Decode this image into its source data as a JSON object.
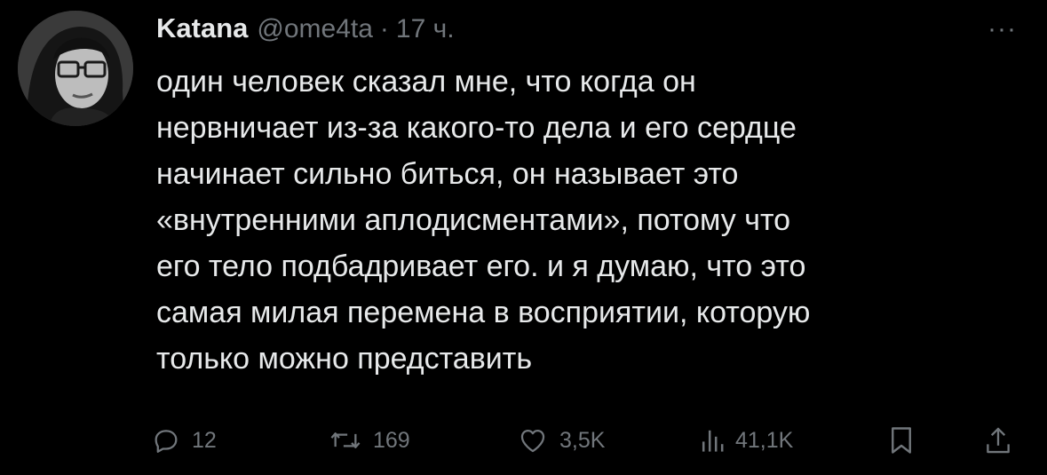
{
  "author": {
    "display_name": "Katana",
    "handle": "@ome4ta",
    "separator": "·",
    "time": "17 ч."
  },
  "more_label": "···",
  "tweet_lines": [
    "один человек сказал мне, что когда он",
    "нервничает из-за какого-то дела и его сердце",
    "начинает сильно биться, он называет это",
    "«внутренними аплодисментами», потому что",
    "его тело подбадривает его. и я думаю, что это",
    "самая милая перемена в восприятии, которую",
    "только можно представить"
  ],
  "actions": {
    "replies": "12",
    "reposts": "169",
    "likes": "3,5K",
    "views": "41,1K"
  },
  "icons": {
    "reply": "reply-icon",
    "repost": "repost-icon",
    "like": "heart-icon",
    "views": "views-icon",
    "bookmark": "bookmark-icon",
    "share": "share-icon"
  },
  "colors": {
    "background": "#000000",
    "text": "#e7e9ea",
    "secondary": "#71767b"
  }
}
